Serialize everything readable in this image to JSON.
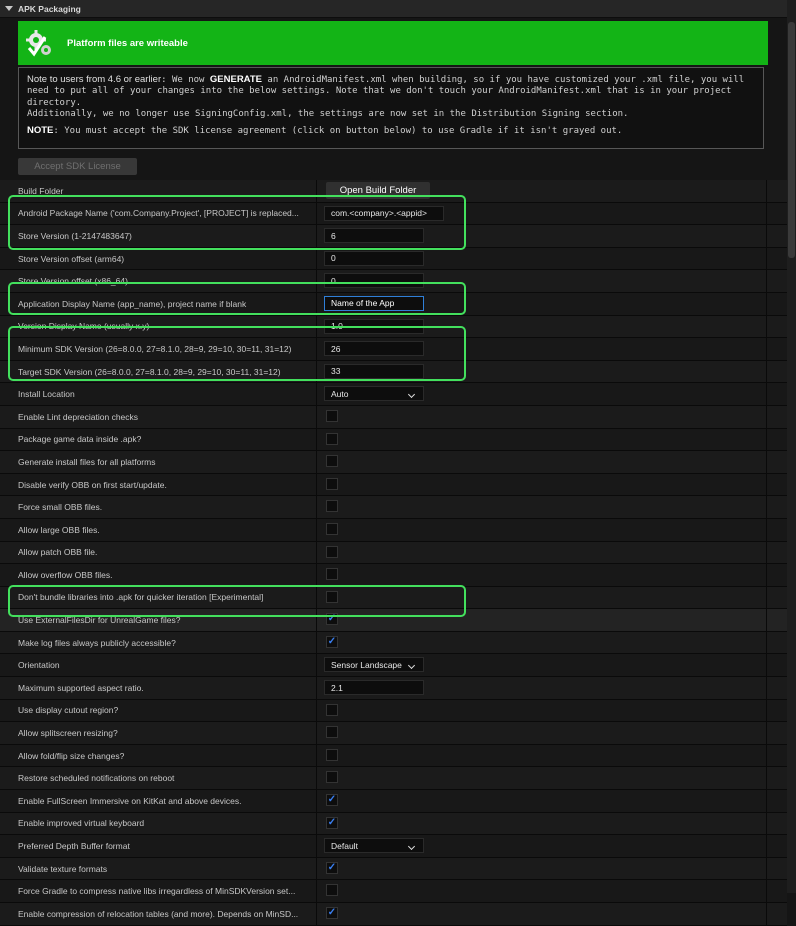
{
  "section": {
    "title": "APK Packaging"
  },
  "banner": {
    "text": "Platform files are writeable"
  },
  "note": {
    "lead": "Note to users from 4.6 or earlier",
    "line1a": ": We now ",
    "generate": "GENERATE",
    "line1b": " an AndroidManifest.xml when building, so if you have customized your .xml file, you will need to put all of your changes into the below settings. Note that we don't touch your AndroidManifest.xml that is in your project directory.",
    "line2": "Additionally, we no longer use SigningConfig.xml, the settings are now set in the Distribution Signing section.",
    "note_label": "NOTE",
    "line3": ": You must accept the SDK license agreement (click on button below) to use Gradle if it isn't grayed out."
  },
  "accept_button": "Accept SDK License",
  "rows": [
    {
      "label": "Build Folder",
      "type": "button",
      "value": "Open Build Folder"
    },
    {
      "label": "Android Package Name ('com.Company.Project', [PROJECT] is replaced...",
      "type": "text-wide",
      "value": "com.<company>.<appid>"
    },
    {
      "label": "Store Version (1-2147483647)",
      "type": "text",
      "value": "6"
    },
    {
      "label": "Store Version offset (arm64)",
      "type": "text",
      "value": "0"
    },
    {
      "label": "Store Version offset (x86_64)",
      "type": "text",
      "value": "0"
    },
    {
      "label": "Application Display Name (app_name), project name if blank",
      "type": "text-focus",
      "value": "Name of the App"
    },
    {
      "label": "Version Display Name (usually x.y)",
      "type": "text",
      "value": "1.0"
    },
    {
      "label": "Minimum SDK Version (26=8.0.0, 27=8.1.0, 28=9, 29=10, 30=11, 31=12)",
      "type": "text",
      "value": "26"
    },
    {
      "label": "Target SDK Version (26=8.0.0, 27=8.1.0, 28=9, 29=10, 30=11, 31=12)",
      "type": "text",
      "value": "33"
    },
    {
      "label": "Install Location",
      "type": "dropdown",
      "value": "Auto"
    },
    {
      "label": "Enable Lint depreciation checks",
      "type": "check",
      "checked": false
    },
    {
      "label": "Package game data inside .apk?",
      "type": "check",
      "checked": false
    },
    {
      "label": "Generate install files for all platforms",
      "type": "check",
      "checked": false
    },
    {
      "label": "Disable verify OBB on first start/update.",
      "type": "check",
      "checked": false
    },
    {
      "label": "Force small OBB files.",
      "type": "check",
      "checked": false
    },
    {
      "label": "Allow large OBB files.",
      "type": "check",
      "checked": false
    },
    {
      "label": "Allow patch OBB file.",
      "type": "check",
      "checked": false
    },
    {
      "label": "Allow overflow OBB files.",
      "type": "check",
      "checked": false
    },
    {
      "label": "Don't bundle libraries into .apk for quicker iteration [Experimental]",
      "type": "check",
      "checked": false
    },
    {
      "label": "Use ExternalFilesDir for UnrealGame files?",
      "type": "check",
      "checked": true
    },
    {
      "label": "Make log files always publicly accessible?",
      "type": "check",
      "checked": true
    },
    {
      "label": "Orientation",
      "type": "dropdown",
      "value": "Sensor Landscape"
    },
    {
      "label": "Maximum supported aspect ratio.",
      "type": "text",
      "value": "2.1"
    },
    {
      "label": "Use display cutout region?",
      "type": "check",
      "checked": false
    },
    {
      "label": "Allow splitscreen resizing?",
      "type": "check",
      "checked": false
    },
    {
      "label": "Allow fold/flip size changes?",
      "type": "check",
      "checked": false
    },
    {
      "label": "Restore scheduled notifications on reboot",
      "type": "check",
      "checked": false
    },
    {
      "label": "Enable FullScreen Immersive on KitKat and above devices.",
      "type": "check",
      "checked": true
    },
    {
      "label": "Enable improved virtual keyboard",
      "type": "check",
      "checked": true
    },
    {
      "label": "Preferred Depth Buffer format",
      "type": "dropdown",
      "value": "Default"
    },
    {
      "label": "Validate texture formats",
      "type": "check",
      "checked": true
    },
    {
      "label": "Force Gradle to compress native libs irregardless of MinSDKVersion set...",
      "type": "check",
      "checked": false
    },
    {
      "label": "Enable compression of relocation tables (and more). Depends on MinSD...",
      "type": "check",
      "checked": true
    }
  ],
  "colors": {
    "highlight": "#43e05d",
    "banner": "#13b416",
    "check": "#3a7ff2"
  }
}
